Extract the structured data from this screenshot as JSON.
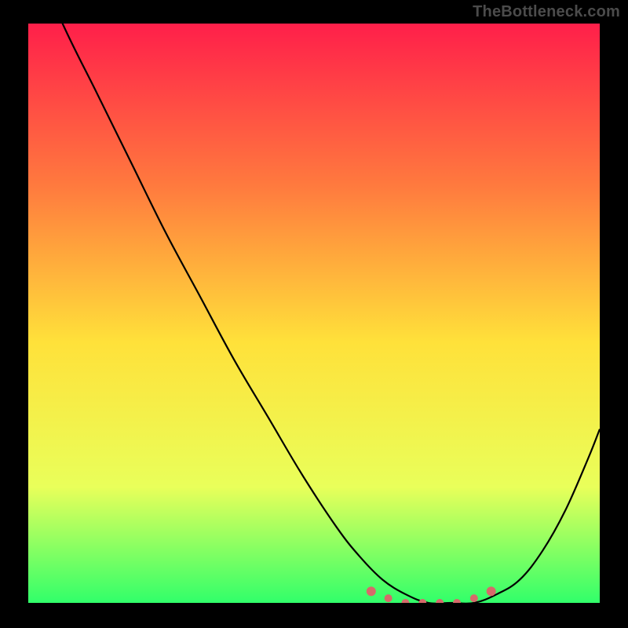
{
  "watermark": "TheBottleneck.com",
  "colors": {
    "background": "#000000",
    "watermark_text": "#4b4b4b",
    "curve_stroke": "#000000",
    "marker_fill": "#d66a6a",
    "gradient": {
      "top": "#ff1f4a",
      "upper_mid": "#ff7a3e",
      "mid": "#ffe13a",
      "lower": "#e9ff5a",
      "bottom": "#31ff6a"
    }
  },
  "chart_data": {
    "type": "line",
    "title": "",
    "xlabel": "",
    "ylabel": "",
    "xlim": [
      0,
      100
    ],
    "ylim": [
      0,
      100
    ],
    "series": [
      {
        "name": "curve",
        "x": [
          0,
          6,
          12,
          18,
          24,
          30,
          36,
          42,
          48,
          54,
          58,
          62,
          66,
          70,
          74,
          78,
          82,
          86,
          90,
          94,
          98,
          100
        ],
        "values": [
          114,
          100,
          88,
          76,
          64,
          53,
          42,
          32,
          22,
          13,
          8,
          4,
          1.5,
          0,
          0,
          0,
          1.5,
          4,
          9,
          16,
          25,
          30
        ]
      }
    ],
    "markers": {
      "name": "flat-minimum",
      "x": [
        60,
        63,
        66,
        69,
        72,
        75,
        78,
        81
      ],
      "values": [
        2,
        0.8,
        0,
        0,
        0,
        0,
        0.8,
        2
      ]
    }
  }
}
